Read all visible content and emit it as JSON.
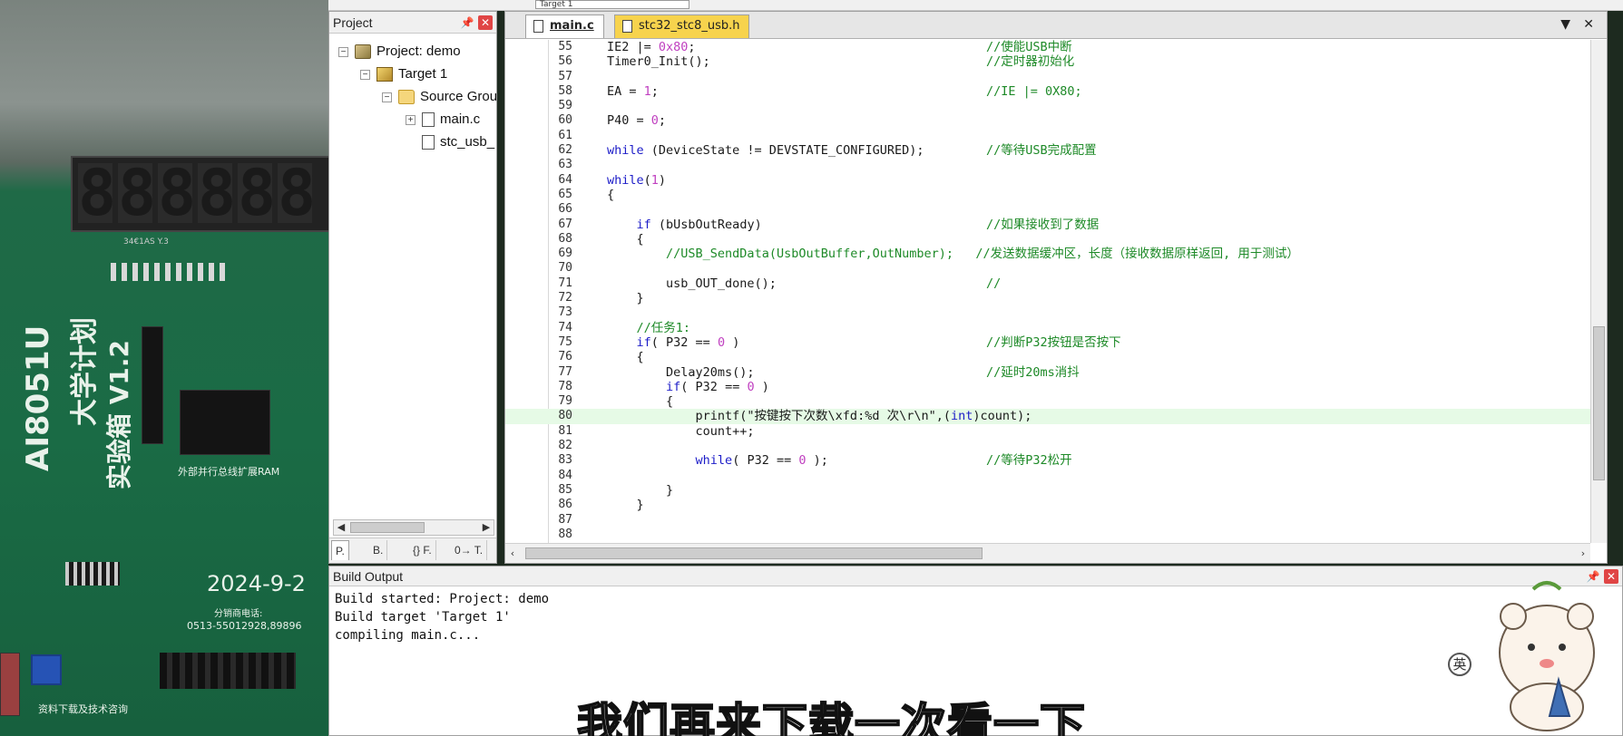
{
  "toolbar": {
    "target_select": "Target 1"
  },
  "project_pane": {
    "title": "Project",
    "tree": [
      {
        "label": "Project: demo"
      },
      {
        "label": "Target 1"
      },
      {
        "label": "Source Grou"
      },
      {
        "label": "main.c"
      },
      {
        "label": "stc_usb_"
      }
    ],
    "tabs": [
      "P.",
      "B.",
      "{} F.",
      "0→ T."
    ]
  },
  "editor": {
    "tabs": [
      {
        "label": "main.c",
        "active": true
      },
      {
        "label": "stc32_stc8_usb.h",
        "active": false
      }
    ],
    "lines": [
      {
        "n": "55",
        "code": "IE2 |= 0x80;",
        "comment": "//使能USB中断"
      },
      {
        "n": "56",
        "code": "Timer0_Init();",
        "comment": "//定时器初始化"
      },
      {
        "n": "57",
        "code": "",
        "comment": ""
      },
      {
        "n": "58",
        "code": "EA = 1;",
        "comment": "//IE |= 0X80;"
      },
      {
        "n": "59",
        "code": "",
        "comment": ""
      },
      {
        "n": "60",
        "code": "P40 = 0;",
        "comment": ""
      },
      {
        "n": "61",
        "code": "",
        "comment": ""
      },
      {
        "n": "62",
        "code": "while (DeviceState != DEVSTATE_CONFIGURED);",
        "comment": "//等待USB完成配置"
      },
      {
        "n": "63",
        "code": "",
        "comment": ""
      },
      {
        "n": "64",
        "code": "while(1)",
        "comment": ""
      },
      {
        "n": "65",
        "code": "{",
        "comment": ""
      },
      {
        "n": "66",
        "code": "",
        "comment": ""
      },
      {
        "n": "67",
        "code": "    if (bUsbOutReady)",
        "comment": "//如果接收到了数据"
      },
      {
        "n": "68",
        "code": "    {",
        "comment": ""
      },
      {
        "n": "69",
        "code": "        //USB_SendData(UsbOutBuffer,OutNumber);   //发送数据缓冲区，长度（接收数据原样返回, 用于测试）",
        "comment": ""
      },
      {
        "n": "70",
        "code": "",
        "comment": ""
      },
      {
        "n": "71",
        "code": "        usb_OUT_done();",
        "comment": "//"
      },
      {
        "n": "72",
        "code": "    }",
        "comment": ""
      },
      {
        "n": "73",
        "code": "",
        "comment": ""
      },
      {
        "n": "74",
        "code": "    //任务1:",
        "comment": ""
      },
      {
        "n": "75",
        "code": "    if( P32 == 0 )",
        "comment": "//判断P32按钮是否按下"
      },
      {
        "n": "76",
        "code": "    {",
        "comment": ""
      },
      {
        "n": "77",
        "code": "        Delay20ms();",
        "comment": "//延时20ms消抖"
      },
      {
        "n": "78",
        "code": "        if( P32 == 0 )",
        "comment": ""
      },
      {
        "n": "79",
        "code": "        {",
        "comment": ""
      },
      {
        "n": "80",
        "code": "            printf(\"按键按下次数\\xfd:%d 次\\r\\n\",(int)count);",
        "comment": ""
      },
      {
        "n": "81",
        "code": "            count++;",
        "comment": ""
      },
      {
        "n": "82",
        "code": "",
        "comment": ""
      },
      {
        "n": "83",
        "code": "            while( P32 == 0 );",
        "comment": "//等待P32松开"
      },
      {
        "n": "84",
        "code": "",
        "comment": ""
      },
      {
        "n": "85",
        "code": "        }",
        "comment": ""
      },
      {
        "n": "86",
        "code": "    }",
        "comment": ""
      },
      {
        "n": "87",
        "code": "",
        "comment": ""
      },
      {
        "n": "88",
        "code": "",
        "comment": ""
      }
    ],
    "highlight_line": "80"
  },
  "build_output": {
    "title": "Build Output",
    "lines": [
      "Build started: Project: demo",
      "Build target 'Target 1'",
      "compiling main.c..."
    ]
  },
  "board": {
    "silk_model": "AI8051U",
    "silk_title": "大学计划",
    "silk_version": "实验箱 V1.2",
    "silk_date": "2024-9-2",
    "silk_phone": "0513-55012928,89896",
    "silk_bus": "外部并行总线扩展RAM",
    "silk_sales": "分销商电话:",
    "silk_download": "资料下载及技术咨询",
    "silk_chip": "34€1AS Y.3"
  },
  "subtitle": "我们再来下载一次看一下",
  "ime_indicator": "英",
  "colors": {
    "keyword": "#1c1cc8",
    "comment": "#1e8a28",
    "number": "#c040c0",
    "highlight": "#e6fae6",
    "active_tab_bg": "#f7d34d"
  }
}
